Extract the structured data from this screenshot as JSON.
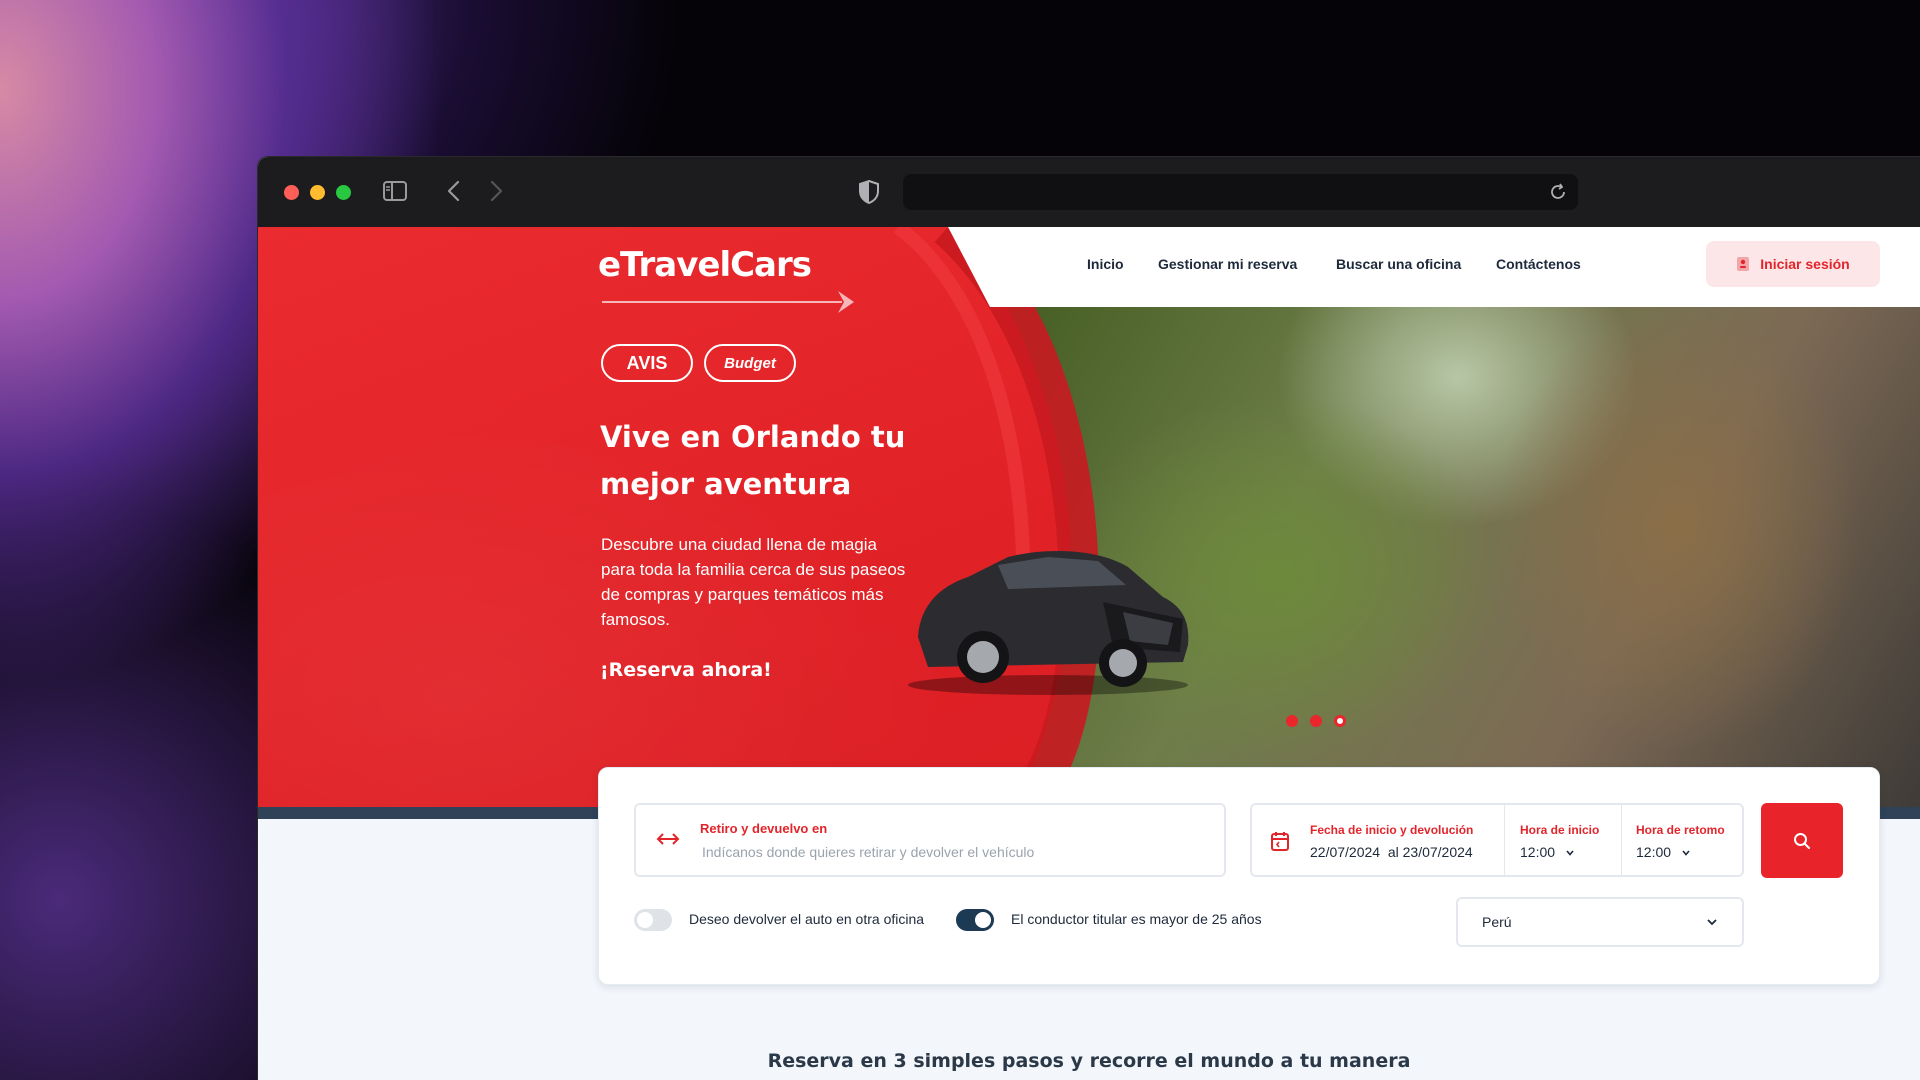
{
  "nav": {
    "items": [
      "Inicio",
      "Gestionar mi reserva",
      "Buscar una oficina",
      "Contáctenos"
    ],
    "login": "Iniciar sesión"
  },
  "brand": {
    "logo": "eTravelCars",
    "partners": [
      "AVIS",
      "Budget"
    ]
  },
  "hero": {
    "title": "Vive en Orlando tu mejor aventura",
    "description": "Descubre una ciudad llena de magia para toda la familia cerca de sus paseos de compras y parques temáticos más famosos.",
    "cta": "¡Reserva ahora!",
    "slides_total": 3,
    "slide_active": 3
  },
  "search": {
    "pickup_label": "Retiro y devuelvo en",
    "pickup_placeholder": "Indícanos donde quieres retirar y devolver el vehículo",
    "dates_label": "Fecha de inicio y devolución",
    "dates_value": "22/07/2024  al 23/07/2024",
    "start_time_label": "Hora de inicio",
    "start_time": "12:00",
    "return_time_label": "Hora de retomo",
    "return_time": "12:00",
    "toggle_other_office": "Deseo devolver el auto en otra oficina",
    "toggle_other_office_on": false,
    "toggle_driver_age": "El conductor titular es mayor de 25 años",
    "toggle_driver_age_on": true,
    "country": "Perú"
  },
  "section": {
    "steps_title": "Reserva en 3 simples pasos y recorre el mundo a tu manera"
  },
  "colors": {
    "brand_red": "#e8262c",
    "navy": "#1d3a54"
  }
}
